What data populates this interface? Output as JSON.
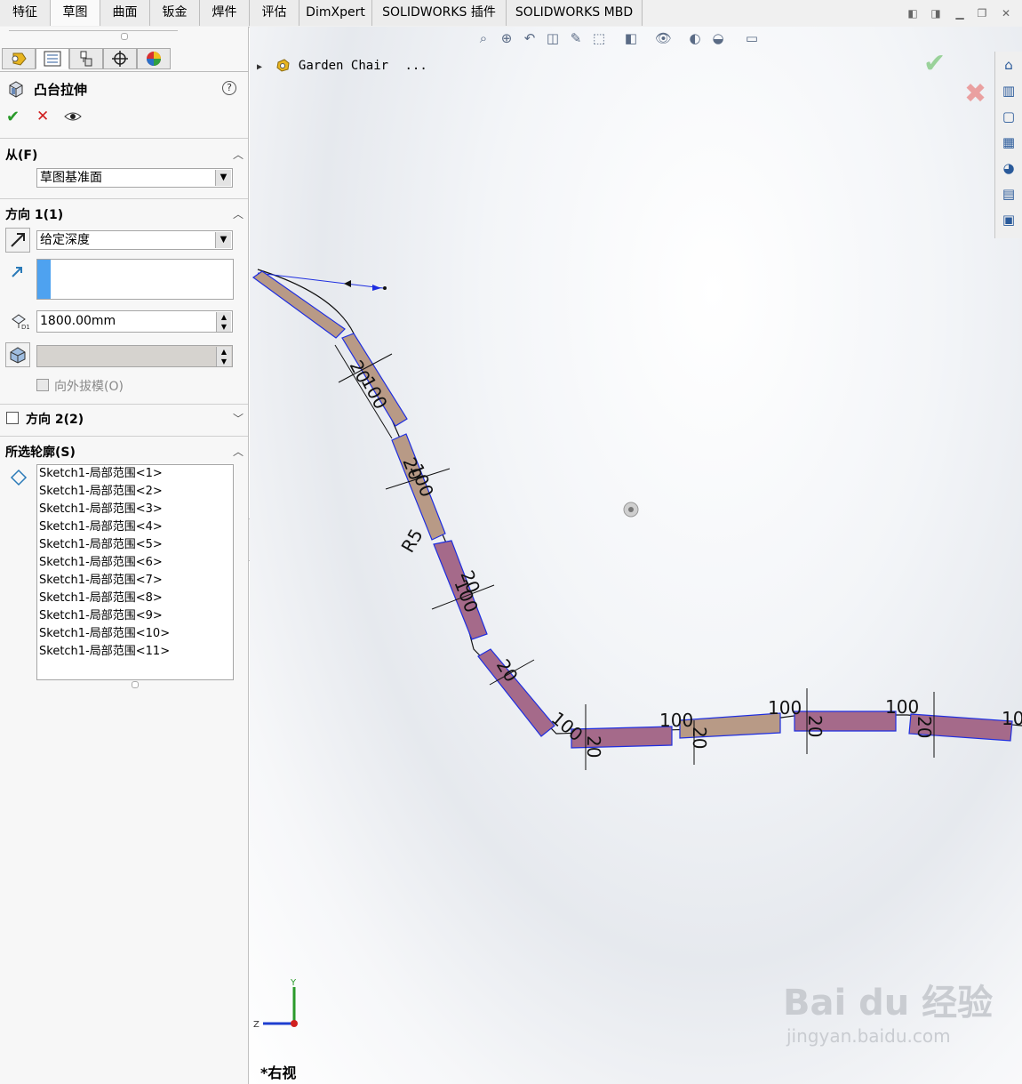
{
  "tabs": [
    {
      "label": "特征"
    },
    {
      "label": "草图"
    },
    {
      "label": "曲面"
    },
    {
      "label": "钣金"
    },
    {
      "label": "焊件"
    },
    {
      "label": "评估"
    },
    {
      "label": "DimXpert"
    },
    {
      "label": "SOLIDWORKS 插件"
    },
    {
      "label": "SOLIDWORKS MBD"
    }
  ],
  "feature": {
    "title": "凸台拉伸",
    "help_glyph": "?"
  },
  "from_section": {
    "title": "从(F)",
    "selected": "草图基准面"
  },
  "direction1": {
    "title": "方向 1(1)",
    "end_condition": "给定深度",
    "depth": "1800.00mm",
    "draft_outward_label": "向外拔模(O)"
  },
  "direction2": {
    "title": "方向 2(2)"
  },
  "selected_contours": {
    "title": "所选轮廓(S)",
    "items": [
      "Sketch1-局部范围<1>",
      "Sketch1-局部范围<2>",
      "Sketch1-局部范围<3>",
      "Sketch1-局部范围<4>",
      "Sketch1-局部范围<5>",
      "Sketch1-局部范围<6>",
      "Sketch1-局部范围<7>",
      "Sketch1-局部范围<8>",
      "Sketch1-局部范围<9>",
      "Sketch1-局部范围<10>",
      "Sketch1-局部范围<11>"
    ]
  },
  "viewport": {
    "tree_item": "Garden Chair",
    "tree_ellipsis": "...",
    "view_name": "*右视",
    "axis_y": "Y",
    "axis_z": "Z",
    "dims": {
      "d1": "20",
      "d2": "100",
      "d3": "20",
      "d4": "100",
      "d5": "R5",
      "d6": "20",
      "d7": "100",
      "d8": "20",
      "d9": "100",
      "d10": "20",
      "d11": "100",
      "d12": "20",
      "d13": "100",
      "d14": "20",
      "d15": "100",
      "d16": "20",
      "d17": "10"
    },
    "watermark_top": "Bai du 经验",
    "watermark_bottom": "jingyan.baidu.com"
  },
  "colors": {
    "accept": "#2a9a2a",
    "cancel": "#d02020",
    "sketch_blue": "#1e2ee0",
    "profile_fill": "#a56a8a",
    "profile_fill2": "#b89a86"
  }
}
